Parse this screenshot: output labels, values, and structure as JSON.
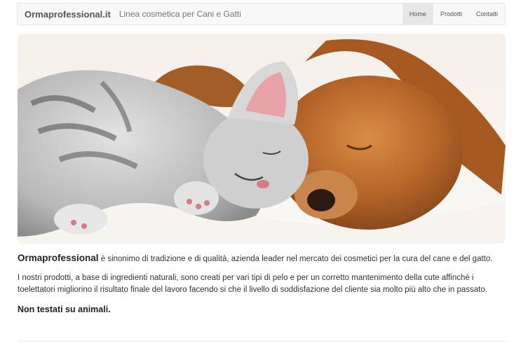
{
  "header": {
    "brand": "Ormaprofessional.it",
    "tagline": "Linea cosmetica per Cani e Gatti",
    "nav": [
      {
        "label": "Home",
        "active": true
      },
      {
        "label": "Prodotti",
        "active": false
      },
      {
        "label": "Contatti",
        "active": false
      }
    ]
  },
  "hero": {
    "image_subject": "kitten-and-puppy-sleeping-photo"
  },
  "main": {
    "intro_brand": "Ormaprofessional",
    "intro_text": " è sinonimo di tradizione e di qualità, azienda leader nel mercato dei cosmetici per la cura del cane e del gatto.",
    "products_text": "I nostri prodotti, a base di ingredienti naturali, sono creati per vari tipi di pelo e per un corretto mantenimento della cute affinchè i toelettatori migliorino il risultato finale del lavoro facendo si che il livello di soddisfazione del cliente sia molto più alto che in passato.",
    "claim": "Non testati su animali."
  },
  "colors": {
    "navbar_bg": "#f8f8f8",
    "active_nav_bg": "#e7e7e7",
    "text": "#333333"
  }
}
